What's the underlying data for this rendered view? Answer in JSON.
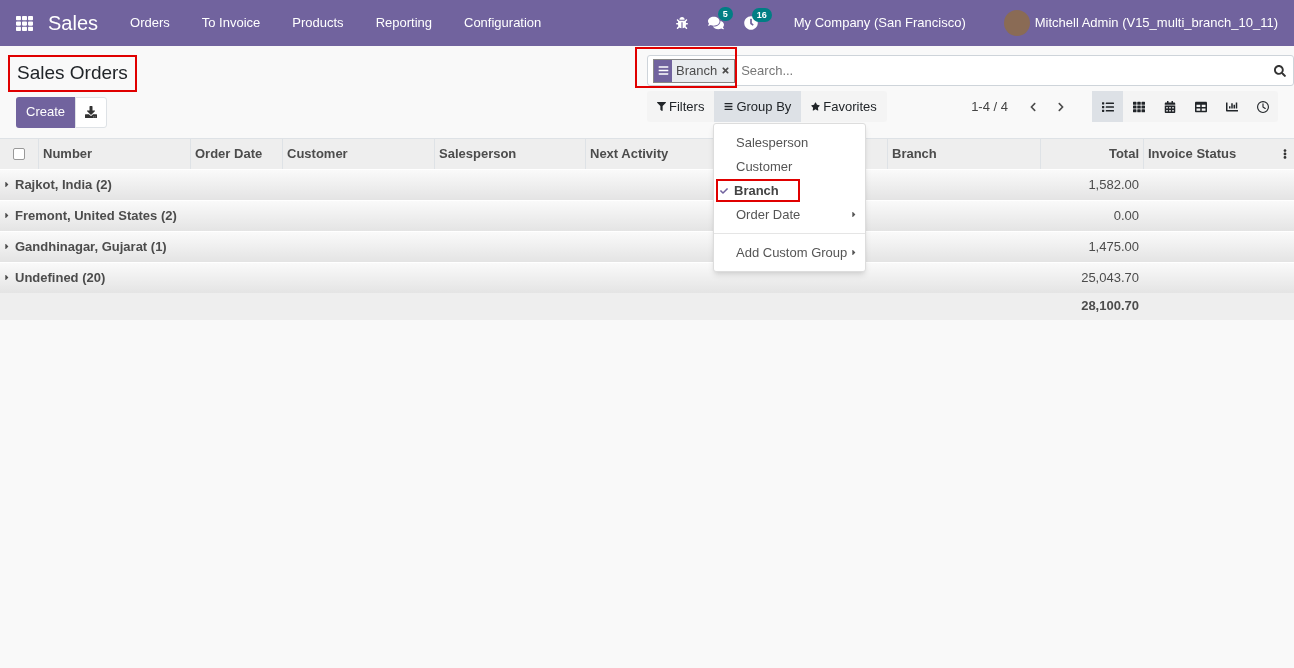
{
  "navbar": {
    "app": "Sales",
    "menu": [
      "Orders",
      "To Invoice",
      "Products",
      "Reporting",
      "Configuration"
    ],
    "messages_count": "5",
    "activities_count": "16",
    "company": "My Company (San Francisco)",
    "user": "Mitchell Admin (V15_multi_branch_10_11)"
  },
  "page": {
    "title": "Sales Orders",
    "title_highlighted": true
  },
  "buttons": {
    "create": "Create"
  },
  "search": {
    "facet": "Branch",
    "facet_highlighted": true,
    "placeholder": "Search..."
  },
  "search_options": [
    {
      "label": "Filters",
      "selected": false
    },
    {
      "label": "Group By",
      "selected": true
    },
    {
      "label": "Favorites",
      "selected": false
    }
  ],
  "pager": "1-4 / 4",
  "views": [
    {
      "kind": "list",
      "selected": true
    },
    {
      "kind": "kanban",
      "selected": false
    },
    {
      "kind": "calendar",
      "selected": false
    },
    {
      "kind": "pivot",
      "selected": false
    },
    {
      "kind": "graph",
      "selected": false
    },
    {
      "kind": "activity",
      "selected": false
    }
  ],
  "table": {
    "select_all_checked": false,
    "columns": [
      "Number",
      "Order Date",
      "Customer",
      "Salesperson",
      "Next Activity",
      "Branch",
      "Total",
      "Invoice Status"
    ],
    "groups": [
      {
        "label": "Rajkot, India (2)",
        "total": "1,582.00"
      },
      {
        "label": "Fremont, United States (2)",
        "total": "0.00"
      },
      {
        "label": "Gandhinagar, Gujarat (1)",
        "total": "1,475.00"
      },
      {
        "label": "Undefined (20)",
        "total": "25,043.70"
      }
    ],
    "grand_total": "28,100.70"
  },
  "group_by_menu": [
    {
      "label": "Salesperson",
      "checked": false,
      "submenu": false,
      "highlighted": false
    },
    {
      "label": "Customer",
      "checked": false,
      "submenu": false,
      "highlighted": false
    },
    {
      "label": "Branch",
      "checked": true,
      "submenu": false,
      "highlighted": true
    },
    {
      "label": "Order Date",
      "checked": false,
      "submenu": true,
      "highlighted": false
    },
    {
      "label": "Add Custom Group",
      "checked": false,
      "submenu": true,
      "highlighted": false,
      "separated": true
    }
  ]
}
